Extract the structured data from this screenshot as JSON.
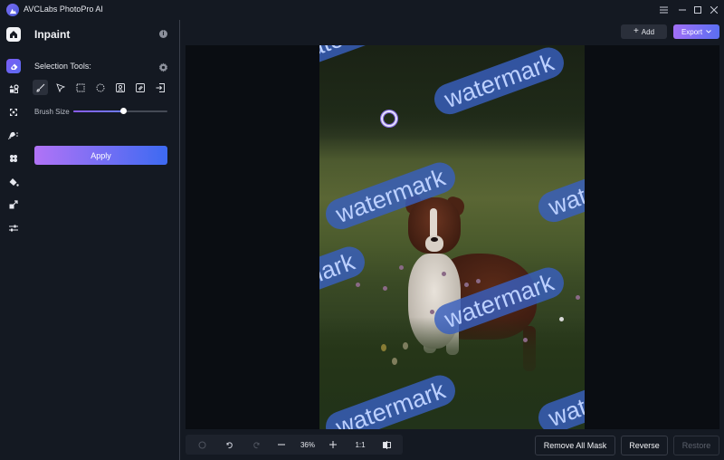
{
  "app": {
    "title": "AVCLabs PhotoPro AI",
    "window_controls": [
      "menu-icon",
      "minimize-icon",
      "maximize-icon",
      "close-icon"
    ]
  },
  "rail": {
    "items": [
      {
        "name": "home",
        "icon": "home-icon"
      },
      {
        "name": "inpaint",
        "icon": "eraser-icon",
        "active": true
      },
      {
        "name": "object-removal",
        "icon": "shapes-icon"
      },
      {
        "name": "enhance",
        "icon": "expand-icon"
      },
      {
        "name": "background",
        "icon": "person-cutout-icon"
      },
      {
        "name": "effects",
        "icon": "clover-icon"
      },
      {
        "name": "colorize",
        "icon": "paint-bucket-icon"
      },
      {
        "name": "upscale",
        "icon": "resize-arrow-icon"
      },
      {
        "name": "adjust",
        "icon": "sliders-icon"
      }
    ]
  },
  "panel": {
    "title": "Inpaint",
    "selection_label": "Selection Tools:",
    "tools": [
      {
        "name": "brush",
        "icon": "brush-icon",
        "active": true
      },
      {
        "name": "lasso",
        "icon": "pointer-icon"
      },
      {
        "name": "rectangle",
        "icon": "rect-select-icon"
      },
      {
        "name": "ellipse",
        "icon": "ellipse-select-icon"
      },
      {
        "name": "subject",
        "icon": "portrait-select-icon"
      },
      {
        "name": "hatch",
        "icon": "pattern-select-icon"
      },
      {
        "name": "import",
        "icon": "import-icon"
      }
    ],
    "brush_label": "Brush Size",
    "brush_size": 0.53,
    "apply_label": "Apply"
  },
  "header": {
    "add_label": "Add",
    "export_label": "Export"
  },
  "canvas": {
    "watermark_text": "watermark",
    "watermarks": [
      "watermark",
      "watermark",
      "watermark",
      "watermark",
      "watermark",
      "watermark",
      "watermark",
      "watermark"
    ]
  },
  "zoombar": {
    "zoom_level": "36%",
    "actual_size": "1:1"
  },
  "actions": {
    "remove_all": "Remove All Mask",
    "reverse": "Reverse",
    "restore": "Restore"
  },
  "colors": {
    "accent_start": "#b173f6",
    "accent_end": "#3d6af2",
    "mask": "#385fbe",
    "background": "#141922",
    "canvas": "#0a0d12"
  }
}
